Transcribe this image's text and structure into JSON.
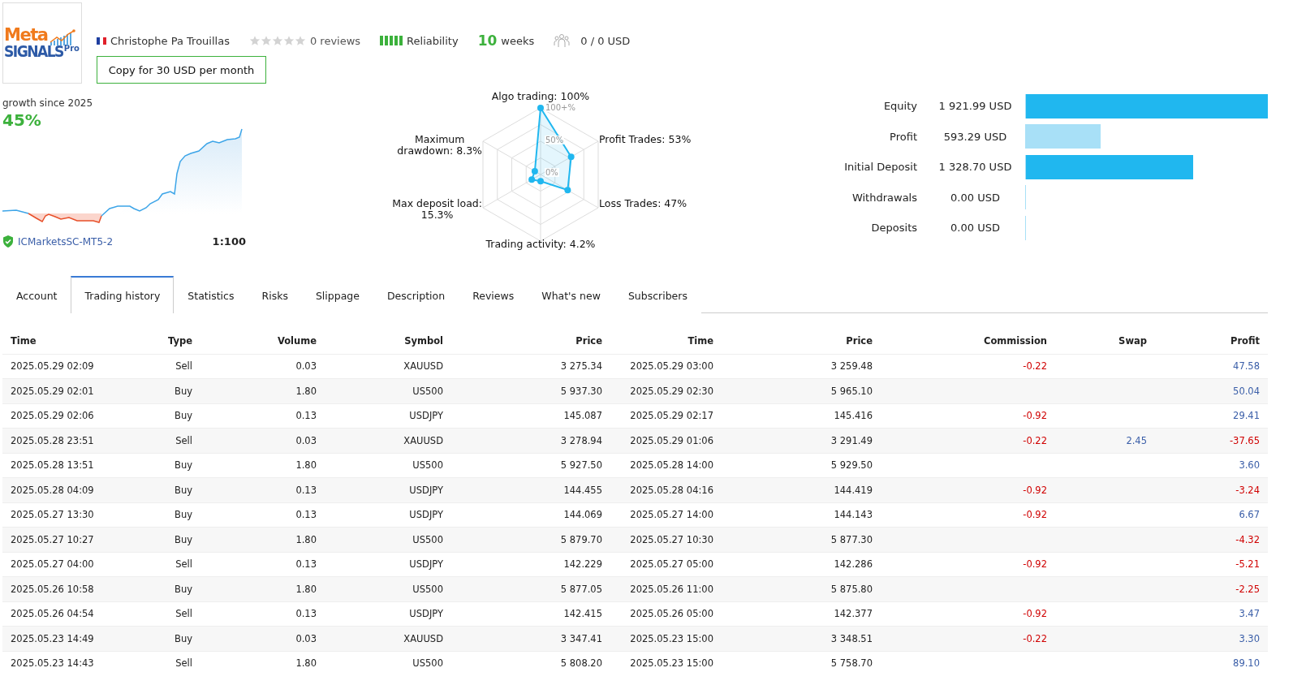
{
  "logo": {
    "line1": "Meta",
    "line2": "SIGNALS",
    "badge": "Pro"
  },
  "author": "Christophe Pa Trouillas",
  "rating": {
    "stars": 0,
    "reviews": "0 reviews"
  },
  "reliability": "Reliability",
  "age": {
    "number": "10",
    "unit": "weeks"
  },
  "subscribers": "0 / 0 USD",
  "copy_button": "Copy for 30 USD per month",
  "growth": {
    "caption": "growth since 2025",
    "value": "45%",
    "server": "ICMarketsSC-MT5-2",
    "leverage": "1:100"
  },
  "radar": {
    "axes": [
      "Algo trading: 100%",
      "Maximum\ndrawdown: 8.3%",
      "Profit Trades: 53%",
      "Max deposit load:\n15.3%",
      "Loss Trades: 47%",
      "Trading activity: 4.2%"
    ],
    "ticks": [
      "100+%",
      "50%",
      "0%"
    ]
  },
  "balance": [
    {
      "label": "Equity",
      "value": "1 921.99 USD",
      "level": 1,
      "highlight": true
    },
    {
      "label": "Profit",
      "value": "593.29 USD",
      "level": 0.31,
      "highlight": false
    },
    {
      "label": "Initial Deposit",
      "value": "1 328.70 USD",
      "level": 0.69,
      "highlight": true
    },
    {
      "label": "Withdrawals",
      "value": "0.00 USD"
    },
    {
      "label": "Deposits",
      "value": "0.00 USD"
    }
  ],
  "tabs": [
    {
      "label": "Account",
      "selected": false
    },
    {
      "label": "Trading history",
      "selected": true
    },
    {
      "label": "Statistics",
      "selected": false
    },
    {
      "label": "Risks",
      "selected": false
    },
    {
      "label": "Slippage",
      "selected": false
    },
    {
      "label": "Description",
      "selected": false
    },
    {
      "label": "Reviews",
      "selected": false
    },
    {
      "label": "What's new",
      "selected": false
    },
    {
      "label": "Subscribers",
      "selected": false
    }
  ],
  "table": {
    "columns": [
      "Time",
      "Type",
      "Volume",
      "Symbol",
      "Price",
      "Time",
      "Price",
      "Commission",
      "Swap",
      "Profit"
    ],
    "rows": [
      {
        "open_time": "2025.05.29 02:09",
        "type": "Sell",
        "volume": "0.03",
        "symbol": "XAUUSD",
        "open_price": "3 275.34",
        "close_time": "2025.05.29 03:00",
        "close_price": "3 259.48",
        "commission": "-0.22",
        "profit": "47.58",
        "loss": false
      },
      {
        "open_time": "2025.05.29 02:01",
        "type": "Buy",
        "volume": "1.80",
        "symbol": "US500",
        "open_price": "5 937.30",
        "close_time": "2025.05.29 02:30",
        "close_price": "5 965.10",
        "profit": "50.04",
        "loss": false
      },
      {
        "open_time": "2025.05.29 02:06",
        "type": "Buy",
        "volume": "0.13",
        "symbol": "USDJPY",
        "open_price": "145.087",
        "close_time": "2025.05.29 02:17",
        "close_price": "145.416",
        "commission": "-0.92",
        "profit": "29.41",
        "loss": false
      },
      {
        "open_time": "2025.05.28 23:51",
        "type": "Sell",
        "volume": "0.03",
        "symbol": "XAUUSD",
        "open_price": "3 278.94",
        "close_time": "2025.05.29 01:06",
        "close_price": "3 291.49",
        "commission": "-0.22",
        "swap": "2.45",
        "profit": "-37.65",
        "loss": true
      },
      {
        "open_time": "2025.05.28 13:51",
        "type": "Buy",
        "volume": "1.80",
        "symbol": "US500",
        "open_price": "5 927.50",
        "close_time": "2025.05.28 14:00",
        "close_price": "5 929.50",
        "profit": "3.60",
        "loss": false
      },
      {
        "open_time": "2025.05.28 04:09",
        "type": "Buy",
        "volume": "0.13",
        "symbol": "USDJPY",
        "open_price": "144.455",
        "close_time": "2025.05.28 04:16",
        "close_price": "144.419",
        "commission": "-0.92",
        "profit": "-3.24",
        "loss": true
      },
      {
        "open_time": "2025.05.27 13:30",
        "type": "Buy",
        "volume": "0.13",
        "symbol": "USDJPY",
        "open_price": "144.069",
        "close_time": "2025.05.27 14:00",
        "close_price": "144.143",
        "commission": "-0.92",
        "profit": "6.67",
        "loss": false
      },
      {
        "open_time": "2025.05.27 10:27",
        "type": "Buy",
        "volume": "1.80",
        "symbol": "US500",
        "open_price": "5 879.70",
        "close_time": "2025.05.27 10:30",
        "close_price": "5 877.30",
        "profit": "-4.32",
        "loss": true
      },
      {
        "open_time": "2025.05.27 04:00",
        "type": "Sell",
        "volume": "0.13",
        "symbol": "USDJPY",
        "open_price": "142.229",
        "close_time": "2025.05.27 05:00",
        "close_price": "142.286",
        "commission": "-0.92",
        "profit": "-5.21",
        "loss": true
      },
      {
        "open_time": "2025.05.26 10:58",
        "type": "Buy",
        "volume": "1.80",
        "symbol": "US500",
        "open_price": "5 877.05",
        "close_time": "2025.05.26 11:00",
        "close_price": "5 875.80",
        "profit": "-2.25",
        "loss": true
      },
      {
        "open_time": "2025.05.26 04:54",
        "type": "Sell",
        "volume": "0.13",
        "symbol": "USDJPY",
        "open_price": "142.415",
        "close_time": "2025.05.26 05:00",
        "close_price": "142.377",
        "commission": "-0.92",
        "profit": "3.47",
        "loss": false
      },
      {
        "open_time": "2025.05.23 14:49",
        "type": "Buy",
        "volume": "0.03",
        "symbol": "XAUUSD",
        "open_price": "3 347.41",
        "close_time": "2025.05.23 15:00",
        "close_price": "3 348.51",
        "commission": "-0.22",
        "profit": "3.30",
        "loss": false
      },
      {
        "open_time": "2025.05.23 14:43",
        "type": "Sell",
        "volume": "1.80",
        "symbol": "US500",
        "open_price": "5 808.20",
        "close_time": "2025.05.23 15:00",
        "close_price": "5 758.70",
        "profit": "89.10",
        "loss": false
      }
    ]
  }
}
